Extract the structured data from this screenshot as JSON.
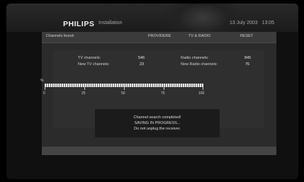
{
  "header": {
    "brand": "PHILIPS",
    "subtitle": "Installation",
    "date": "13 July 2003",
    "time": "13:05"
  },
  "tabbar": {
    "channels_found": "Channels found:",
    "tabs": [
      "PROVIDERE",
      "TV & RADIO",
      "RESET"
    ]
  },
  "stats": {
    "tv_channels_label": "TV channels:",
    "tv_channels_value": "546",
    "new_tv_label": "New TV channels:",
    "new_tv_value": "23",
    "radio_channels_label": "Radio channels:",
    "radio_channels_value": "845",
    "new_radio_label": "New Radio channels:",
    "new_radio_value": "76"
  },
  "progress": {
    "percent_symbol": "%",
    "ticks": [
      "0",
      "25",
      "50",
      "75",
      "100"
    ],
    "value_percent": 100
  },
  "message": {
    "line1": "Channel search completed!",
    "line2": "SAVING IN PROGRESS...",
    "line3": "Do not unplug the receiver."
  }
}
